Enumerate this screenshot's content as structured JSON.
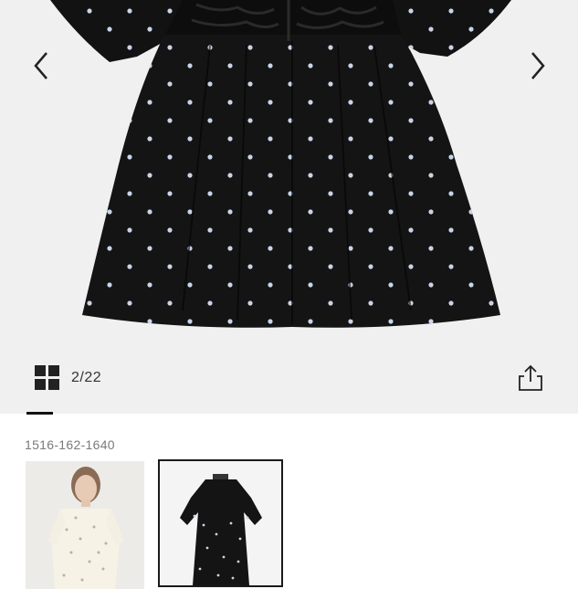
{
  "viewer": {
    "image_counter": "2/22",
    "icons": {
      "prev": "chevron-left-icon",
      "next": "chevron-right-icon",
      "grid": "grid-view-icon",
      "share": "share-icon"
    }
  },
  "product": {
    "sku": "1516-162-1640"
  },
  "thumbnails": [
    {
      "description": "model wearing cream dotted dress"
    },
    {
      "description": "black dotted dress flat shot",
      "selected": true
    }
  ],
  "colors": {
    "background": "#f0f0f0",
    "garment": "#111111",
    "dot": "#c9d4e6",
    "text_muted": "#7a7a7a",
    "indicator": "#111111"
  }
}
